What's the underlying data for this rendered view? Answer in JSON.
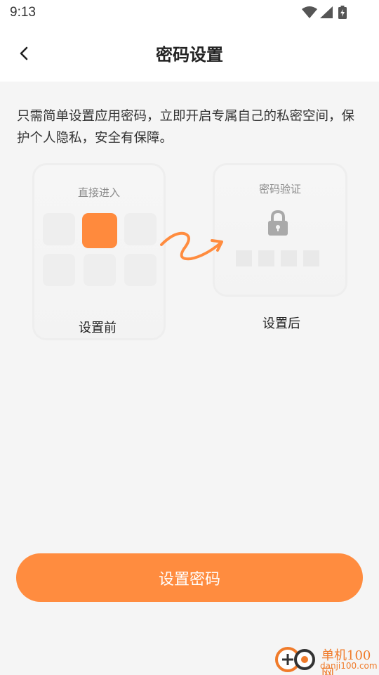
{
  "status_bar": {
    "time": "9:13",
    "icons": [
      "wifi-icon",
      "signal-icon",
      "battery-charging-icon"
    ]
  },
  "header": {
    "back_icon": "chevron-left-icon",
    "title": "密码设置"
  },
  "main": {
    "description": "只需简单设置应用密码，立即开启专属自己的私密空间，保护个人隐私，安全有保障。",
    "before_card": {
      "heading": "直接进入",
      "label": "设置前"
    },
    "after_card": {
      "heading": "密码验证",
      "label": "设置后"
    },
    "primary_button": "设置密码"
  },
  "watermark": {
    "brand": "单机100网",
    "domain": "danji100.com"
  },
  "colors": {
    "accent": "#ff8c3f",
    "background": "#f5f5f5",
    "header_bg": "#ffffff"
  }
}
